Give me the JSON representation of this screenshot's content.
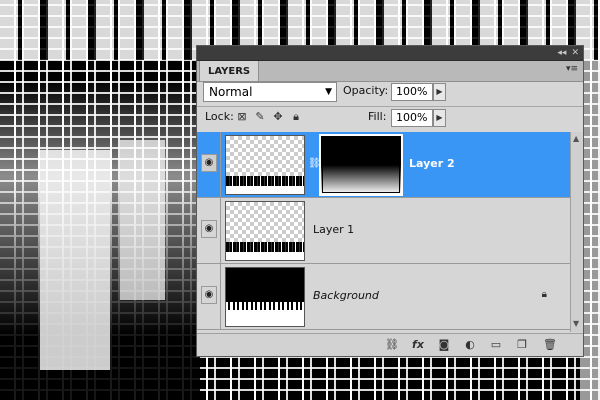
{
  "panel": {
    "title": "LAYERS",
    "collapse_icon": "double-chevron-icon",
    "close_icon": "close-icon",
    "menu_icon": "panel-menu-icon"
  },
  "controls": {
    "blend_mode": "Normal",
    "opacity_label": "Opacity:",
    "opacity_value": "100%",
    "lock_label": "Lock:",
    "fill_label": "Fill:",
    "fill_value": "100%"
  },
  "layers": [
    {
      "name": "Layer 2",
      "selected": true,
      "has_mask": true,
      "visible": true
    },
    {
      "name": "Layer 1",
      "selected": false,
      "has_mask": false,
      "visible": true
    },
    {
      "name": "Background",
      "selected": false,
      "locked": true,
      "visible": true
    }
  ],
  "bottom_icons": [
    "link-layers-icon",
    "fx-icon",
    "add-mask-icon",
    "adjustment-layer-icon",
    "new-group-icon",
    "new-layer-icon",
    "trash-icon"
  ],
  "colors": {
    "selection": "#3a96f5",
    "panel": "#d6d6d6"
  }
}
